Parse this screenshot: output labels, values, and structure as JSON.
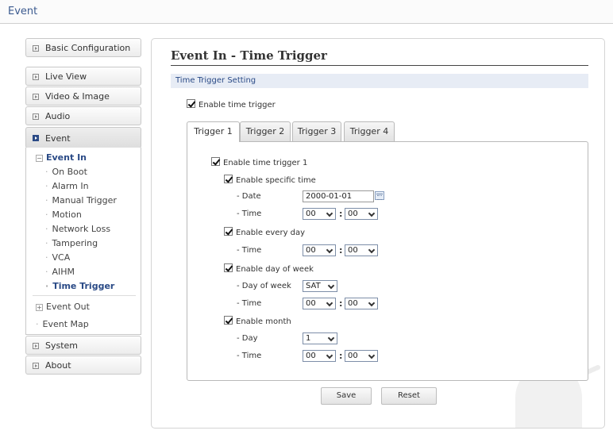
{
  "topbar": {
    "title": "Event"
  },
  "sidebar": {
    "items": [
      {
        "label": "Basic Configuration"
      },
      {
        "label": "Live View"
      },
      {
        "label": "Video & Image"
      },
      {
        "label": "Audio"
      },
      {
        "label": "Event"
      },
      {
        "label": "System"
      },
      {
        "label": "About"
      }
    ],
    "event_in": {
      "label": "Event In",
      "expander": "−",
      "subitems": [
        "On Boot",
        "Alarm In",
        "Manual Trigger",
        "Motion",
        "Network Loss",
        "Tampering",
        "VCA",
        "AIHM",
        "Time Trigger"
      ]
    },
    "event_out": {
      "label": "Event Out",
      "expander": "+"
    },
    "event_map": {
      "label": "Event Map"
    }
  },
  "page": {
    "title": "Event In - Time Trigger",
    "section": "Time Trigger Setting",
    "enable_main": "Enable time trigger",
    "tabs": [
      "Trigger 1",
      "Trigger 2",
      "Trigger 3",
      "Trigger 4"
    ],
    "enable_trigger": "Enable time trigger 1",
    "specific": {
      "label": "Enable specific time",
      "date_label": "- Date",
      "date_value": "2000-01-01",
      "time_label": "- Time",
      "hour": "00",
      "minute": "00"
    },
    "every_day": {
      "label": "Enable every day",
      "time_label": "- Time",
      "hour": "00",
      "minute": "00"
    },
    "day_of_week": {
      "label": "Enable day of week",
      "dow_label": "- Day of week",
      "dow_value": "SAT",
      "time_label": "- Time",
      "hour": "00",
      "minute": "00"
    },
    "month": {
      "label": "Enable month",
      "day_label": "- Day",
      "day_value": "1",
      "time_label": "- Time",
      "hour": "00",
      "minute": "00"
    },
    "colon": ":",
    "save": "Save",
    "reset": "Reset"
  },
  "colors": {
    "accent": "#2a4a86",
    "section_bg": "#e7ecf5"
  }
}
